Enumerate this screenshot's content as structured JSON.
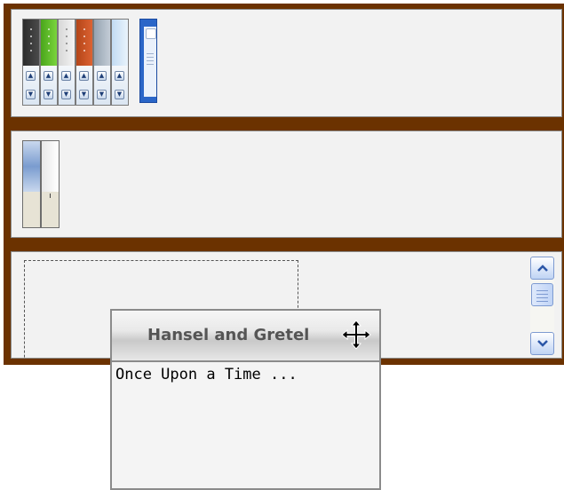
{
  "dialog": {
    "title": "Hansel and Gretel",
    "body": "Once Upon a Time ..."
  },
  "icons": {
    "move": "move-arrows-icon",
    "scroll_up": "chevron-up-icon",
    "scroll_down": "chevron-down-icon",
    "scroll_thumb": "scroll-thumb-grip-icon",
    "spinner_up": "arrow-up-icon",
    "spinner_down": "arrow-down-icon"
  },
  "skins": [
    "#3a3a3a",
    "#5fbf2c",
    "#e8e8e8",
    "#c9501f",
    "#a7b3bf",
    "#cfe0f1",
    "#2a66c8"
  ],
  "colors": {
    "frame": "#6b3200",
    "panel_bg": "#f2f2f2",
    "dialog_border": "#8b8b8b",
    "scroll_accent": "#2c57a8"
  }
}
